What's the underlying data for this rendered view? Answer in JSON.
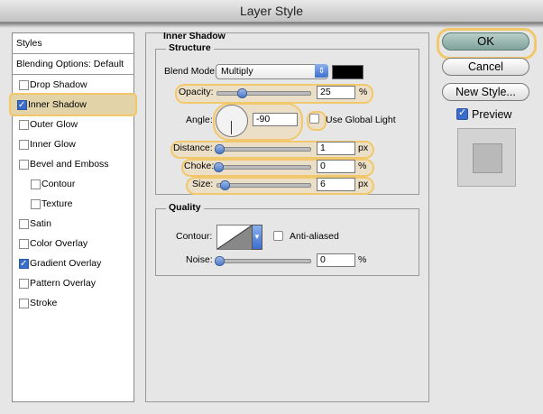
{
  "window": {
    "title": "Layer Style"
  },
  "sidebar": {
    "header": "Styles",
    "blending_label": "Blending Options: Default",
    "items": [
      {
        "label": "Drop Shadow",
        "checked": false,
        "indent": false,
        "selected": false
      },
      {
        "label": "Inner Shadow",
        "checked": true,
        "indent": false,
        "selected": true
      },
      {
        "label": "Outer Glow",
        "checked": false,
        "indent": false,
        "selected": false
      },
      {
        "label": "Inner Glow",
        "checked": false,
        "indent": false,
        "selected": false
      },
      {
        "label": "Bevel and Emboss",
        "checked": false,
        "indent": false,
        "selected": false
      },
      {
        "label": "Contour",
        "checked": false,
        "indent": true,
        "selected": false
      },
      {
        "label": "Texture",
        "checked": false,
        "indent": true,
        "selected": false
      },
      {
        "label": "Satin",
        "checked": false,
        "indent": false,
        "selected": false
      },
      {
        "label": "Color Overlay",
        "checked": false,
        "indent": false,
        "selected": false
      },
      {
        "label": "Gradient Overlay",
        "checked": true,
        "indent": false,
        "selected": false
      },
      {
        "label": "Pattern Overlay",
        "checked": false,
        "indent": false,
        "selected": false
      },
      {
        "label": "Stroke",
        "checked": false,
        "indent": false,
        "selected": false
      }
    ]
  },
  "panel": {
    "title": "Inner Shadow",
    "structure": {
      "legend": "Structure",
      "blend_mode_label": "Blend Mode:",
      "blend_mode_value": "Multiply",
      "swatch_color": "#000000",
      "opacity_label": "Opacity:",
      "opacity_value": "25",
      "opacity_unit": "%",
      "angle_label": "Angle:",
      "angle_value": "-90",
      "global_light_label": "Use Global Light",
      "distance_label": "Distance:",
      "distance_value": "1",
      "distance_unit": "px",
      "choke_label": "Choke:",
      "choke_value": "0",
      "choke_unit": "%",
      "size_label": "Size:",
      "size_value": "6",
      "size_unit": "px"
    },
    "quality": {
      "legend": "Quality",
      "contour_label": "Contour:",
      "anti_aliased_label": "Anti-aliased",
      "noise_label": "Noise:",
      "noise_value": "0",
      "noise_unit": "%"
    }
  },
  "buttons": {
    "ok": "OK",
    "cancel": "Cancel",
    "new_style": "New Style...",
    "preview_label": "Preview"
  },
  "colors": {
    "highlight": "#f2c86c",
    "accent": "#3c6fd0"
  }
}
